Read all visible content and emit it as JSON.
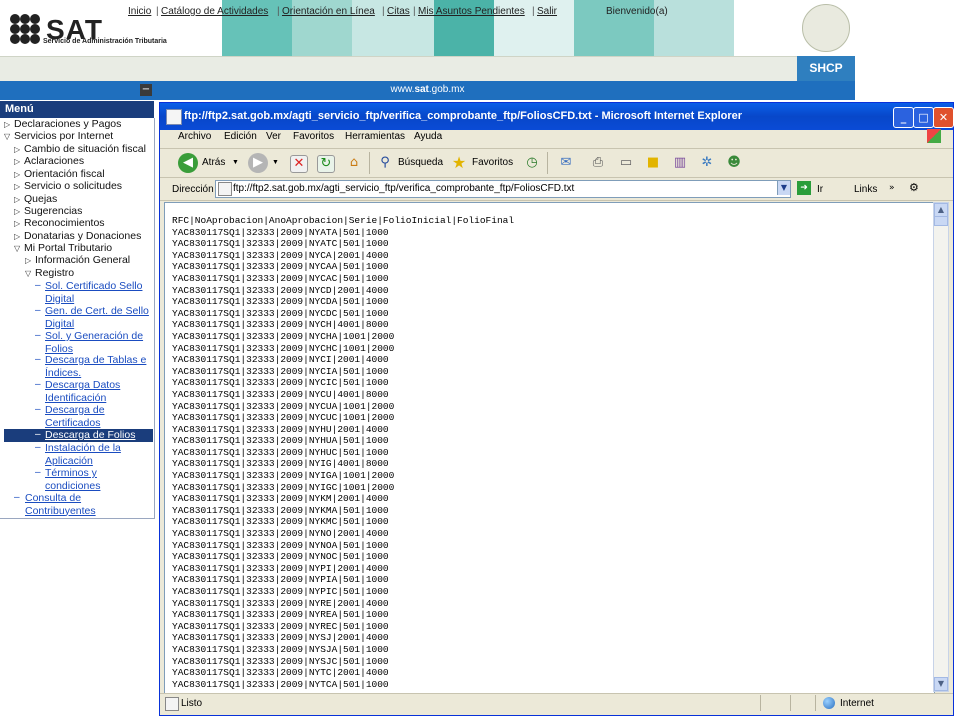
{
  "header": {
    "logo": "SAT",
    "logo_subtitle": "Servicio de Administración Tributaria",
    "tile_colors": [
      "#66c2b8",
      "#9fd7cf",
      "#c7e7e3",
      "#4bb3a8",
      "#dff1ef",
      "#7cc9c0",
      "#b9e0dc"
    ]
  },
  "nav": {
    "links": [
      "Inicio",
      "Catálogo de Actividades",
      "Orientación en Línea",
      "Citas",
      "Mis Asuntos Pendientes",
      "Salir"
    ],
    "separator": "|",
    "welcome": "Bienvenido(a)",
    "agency": "SHCP"
  },
  "site": {
    "url_left": "www.",
    "url_bold": "sat",
    "url_right": ".gob.mx",
    "collapse": "−"
  },
  "menu": {
    "title": "Menú",
    "items": [
      {
        "glyph": "▷",
        "label": "Declaraciones y Pagos"
      },
      {
        "glyph": "▽",
        "label": "Servicios por Internet"
      },
      {
        "glyph": "▷",
        "label": "Cambio de situación fiscal"
      },
      {
        "glyph": "▷",
        "label": "Aclaraciones"
      },
      {
        "glyph": "▷",
        "label": "Orientación fiscal"
      },
      {
        "glyph": "▷",
        "label": "Servicio o solicitudes"
      },
      {
        "glyph": "▷",
        "label": "Quejas"
      },
      {
        "glyph": "▷",
        "label": "Sugerencias"
      },
      {
        "glyph": "▷",
        "label": "Reconocimientos"
      },
      {
        "glyph": "▷",
        "label": "Donatarias y Donaciones"
      },
      {
        "glyph": "▽",
        "label": "Mi Portal Tributario"
      },
      {
        "glyph": "▷",
        "label": "Información General"
      },
      {
        "glyph": "▽",
        "label": "Registro"
      }
    ],
    "links": [
      {
        "l1": "Sol. Certificado Sello",
        "l2": "Digital"
      },
      {
        "l1": "Gen. de Cert. de Sello",
        "l2": "Digital"
      },
      {
        "l1": "Sol. y Generación de",
        "l2": "Folios"
      },
      {
        "l1": "Descarga de Tablas e",
        "l2": "Índices."
      },
      {
        "l1": "Descarga Datos",
        "l2": "Identificación"
      },
      {
        "l1": "Descarga de",
        "l2": "Certificados"
      },
      {
        "l1": "Descarga de Folios",
        "l2": ""
      },
      {
        "l1": "Instalación de la",
        "l2": "Aplicación"
      },
      {
        "l1": "Términos y",
        "l2": "condiciones"
      }
    ],
    "consulta_l1": "Consulta de",
    "consulta_l2": "Contribuyentes",
    "dash": "–"
  },
  "ie": {
    "title": "ftp://ftp2.sat.gob.mx/agti_servicio_ftp/verifica_comprobante_ftp/FoliosCFD.txt - Microsoft Internet Explorer",
    "buttons": {
      "minimize": "_",
      "maximize": "□",
      "close": "✕"
    },
    "menus": [
      "Archivo",
      "Edición",
      "Ver",
      "Favoritos",
      "Herramientas",
      "Ayuda"
    ],
    "toolbar": {
      "back": "Atrás",
      "search": "Búsqueda",
      "favorites": "Favoritos"
    },
    "address_label": "Dirección",
    "address_value": "ftp://ftp2.sat.gob.mx/agti_servicio_ftp/verifica_comprobante_ftp/FoliosCFD.txt",
    "go_label": "Ir",
    "links_label": "Links",
    "status": "Listo",
    "zone": "Internet"
  },
  "file": {
    "header": "RFC|NoAprobacion|AnoAprobacion|Serie|FolioInicial|FolioFinal",
    "rows": [
      "YAC830117SQ1|32333|2009|NYATA|501|1000",
      "YAC830117SQ1|32333|2009|NYATC|501|1000",
      "YAC830117SQ1|32333|2009|NYCA|2001|4000",
      "YAC830117SQ1|32333|2009|NYCAA|501|1000",
      "YAC830117SQ1|32333|2009|NYCAC|501|1000",
      "YAC830117SQ1|32333|2009|NYCD|2001|4000",
      "YAC830117SQ1|32333|2009|NYCDA|501|1000",
      "YAC830117SQ1|32333|2009|NYCDC|501|1000",
      "YAC830117SQ1|32333|2009|NYCH|4001|8000",
      "YAC830117SQ1|32333|2009|NYCHA|1001|2000",
      "YAC830117SQ1|32333|2009|NYCHC|1001|2000",
      "YAC830117SQ1|32333|2009|NYCI|2001|4000",
      "YAC830117SQ1|32333|2009|NYCIA|501|1000",
      "YAC830117SQ1|32333|2009|NYCIC|501|1000",
      "YAC830117SQ1|32333|2009|NYCU|4001|8000",
      "YAC830117SQ1|32333|2009|NYCUA|1001|2000",
      "YAC830117SQ1|32333|2009|NYCUC|1001|2000",
      "YAC830117SQ1|32333|2009|NYHU|2001|4000",
      "YAC830117SQ1|32333|2009|NYHUA|501|1000",
      "YAC830117SQ1|32333|2009|NYHUC|501|1000",
      "YAC830117SQ1|32333|2009|NYIG|4001|8000",
      "YAC830117SQ1|32333|2009|NYIGA|1001|2000",
      "YAC830117SQ1|32333|2009|NYIGC|1001|2000",
      "YAC830117SQ1|32333|2009|NYKM|2001|4000",
      "YAC830117SQ1|32333|2009|NYKMA|501|1000",
      "YAC830117SQ1|32333|2009|NYKMC|501|1000",
      "YAC830117SQ1|32333|2009|NYNO|2001|4000",
      "YAC830117SQ1|32333|2009|NYNOA|501|1000",
      "YAC830117SQ1|32333|2009|NYNOC|501|1000",
      "YAC830117SQ1|32333|2009|NYPI|2001|4000",
      "YAC830117SQ1|32333|2009|NYPIA|501|1000",
      "YAC830117SQ1|32333|2009|NYPIC|501|1000",
      "YAC830117SQ1|32333|2009|NYRE|2001|4000",
      "YAC830117SQ1|32333|2009|NYREA|501|1000",
      "YAC830117SQ1|32333|2009|NYREC|501|1000",
      "YAC830117SQ1|32333|2009|NYSJ|2001|4000",
      "YAC830117SQ1|32333|2009|NYSJA|501|1000",
      "YAC830117SQ1|32333|2009|NYSJC|501|1000",
      "YAC830117SQ1|32333|2009|NYTC|2001|4000",
      "YAC830117SQ1|32333|2009|NYTCA|501|1000"
    ]
  },
  "colors": {
    "ie_title": "#0a4bd6",
    "site_bar": "#1f6fbe",
    "menu_header": "#1a3d7c",
    "link": "#1a4cc0"
  }
}
